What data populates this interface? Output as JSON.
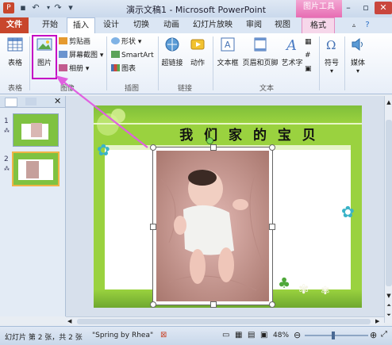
{
  "window": {
    "title": "演示文稿1 - Microsoft PowerPoint",
    "context_tool_title": "图片工具",
    "accent_color": "#c8462c",
    "context_color": "#e76db3",
    "quick_access": {
      "undo": "↶",
      "redo": "↷",
      "customize": "▾"
    }
  },
  "tabs": [
    "文件",
    "开始",
    "插入",
    "设计",
    "切换",
    "动画",
    "幻灯片放映",
    "审阅",
    "视图",
    "格式"
  ],
  "active_tab": "插入",
  "ribbon": {
    "groups": {
      "tables": "表格",
      "images": "图像",
      "illustrations": "插图",
      "links": "链接",
      "text": "文本",
      "symbols_label": "符号",
      "media": "媒体"
    },
    "buttons": {
      "table": "表格",
      "picture": "图片",
      "clipart": "剪贴画",
      "screenshot": "屏幕截图",
      "album": "相册",
      "shapes": "形状",
      "smartart": "SmartArt",
      "chart": "图表",
      "hyperlink": "超链接",
      "action": "动作",
      "textbox": "文本框",
      "header_footer": "页眉和页脚",
      "wordart": "艺术字",
      "symbol": "符号",
      "media": "媒体"
    }
  },
  "thumbnails": [
    {
      "num": "1",
      "icon": "⁂",
      "selected": false
    },
    {
      "num": "2",
      "icon": "⁂",
      "selected": true
    }
  ],
  "slide": {
    "heading": "我 们 家 的 宝 贝",
    "background_color": "#9ad23f"
  },
  "statusbar": {
    "slide_info": "幻灯片 第 2 张，共 2 张",
    "theme": "\"Spring by Rhea\"",
    "zoom": "48%"
  }
}
